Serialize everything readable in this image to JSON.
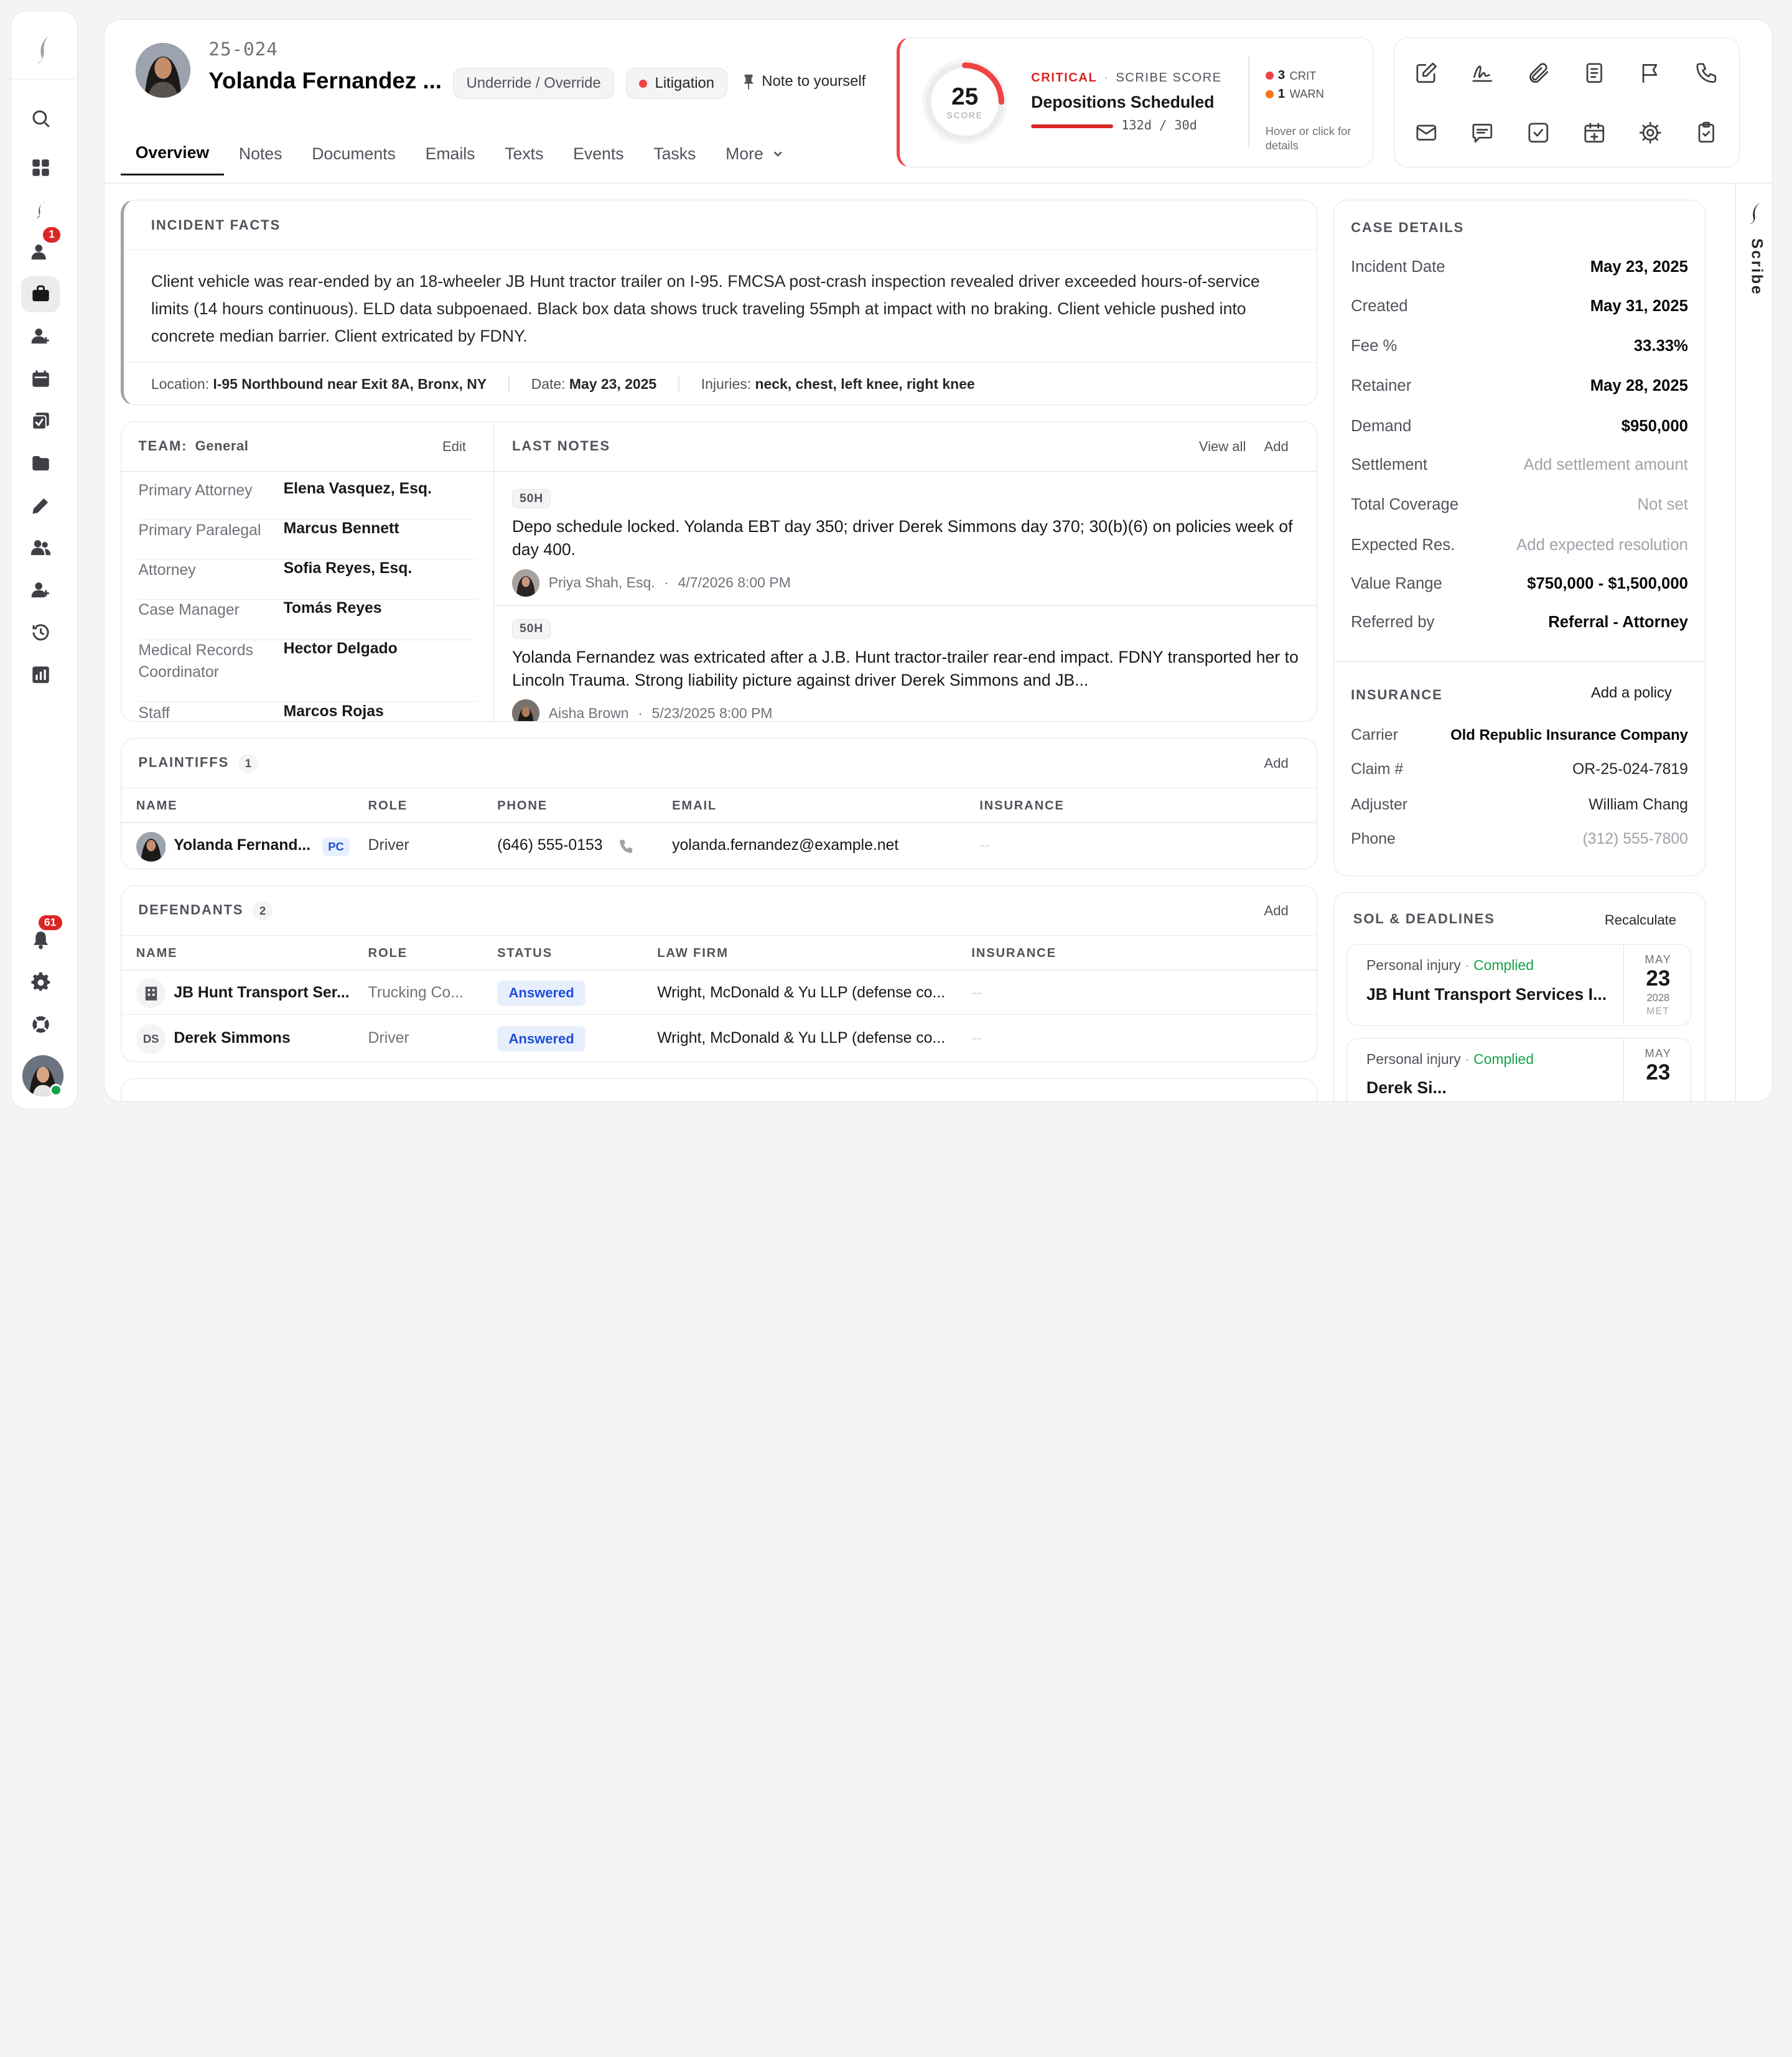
{
  "rail": {
    "badges": {
      "inbox": "1",
      "notifications": "61"
    }
  },
  "header": {
    "case_number": "25-024",
    "client_name": "Yolanda Fernandez ...",
    "chip_override": "Underride / Override",
    "chip_litigation": "Litigation",
    "note_to_self": "Note to yourself",
    "tabs": [
      "Overview",
      "Notes",
      "Documents",
      "Emails",
      "Texts",
      "Events",
      "Tasks",
      "More"
    ]
  },
  "score": {
    "value": "25",
    "value_num": 25,
    "label": "SCORE",
    "level": "CRITICAL",
    "sep": "·",
    "name": "SCRIBE SCORE",
    "title": "Depositions Scheduled",
    "days": "132d / 30d",
    "crit_count": "3",
    "crit_label": "CRIT",
    "warn_count": "1",
    "warn_label": "WARN",
    "hint": "Hover or click for details"
  },
  "incident": {
    "heading": "INCIDENT FACTS",
    "text": "Client vehicle was rear-ended by an 18-wheeler JB Hunt tractor trailer on I-95. FMCSA post-crash inspection revealed driver exceeded hours-of-service limits (14 hours continuous). ELD data subpoenaed. Black box data shows truck traveling 55mph at impact with no braking. Client vehicle pushed into concrete median barrier. Client extricated by FDNY.",
    "location_label": "Location:",
    "location": "I-95 Northbound near Exit 8A, Bronx, NY",
    "date_label": "Date:",
    "date": "May 23, 2025",
    "injuries_label": "Injuries:",
    "injuries": "neck, chest, left knee, right knee"
  },
  "team": {
    "heading": "TEAM:",
    "group": "General",
    "edit": "Edit",
    "rows": [
      {
        "role": "Primary Attorney",
        "name": "Elena Vasquez, Esq."
      },
      {
        "role": "Primary Paralegal",
        "name": "Marcus Bennett"
      },
      {
        "role": "Attorney",
        "name": "Sofia Reyes, Esq."
      },
      {
        "role": "Case Manager",
        "name": "Tomás Reyes"
      },
      {
        "role": "Medical Records Coordinator",
        "name": "Hector Delgado"
      },
      {
        "role": "Staff",
        "name": "Marcos Rojas"
      }
    ]
  },
  "notes": {
    "heading": "LAST NOTES",
    "view_all": "View all",
    "add": "Add",
    "items": [
      {
        "tag": "50H",
        "body": "Depo schedule locked. Yolanda EBT day 350; driver Derek Simmons day 370; 30(b)(6) on policies week of day 400.",
        "author": "Priya Shah, Esq.",
        "sep": "·",
        "time": "4/7/2026 8:00 PM"
      },
      {
        "tag": "50H",
        "body": "Yolanda Fernandez was extricated after a J.B. Hunt tractor-trailer rear-end impact. FDNY transported her to Lincoln Trauma. Strong liability picture against driver Derek Simmons and JB...",
        "author": "Aisha Brown",
        "sep": "·",
        "time": "5/23/2025 8:00 PM"
      }
    ]
  },
  "plaintiffs": {
    "heading": "PLAINTIFFS",
    "count": "1",
    "add": "Add",
    "columns": [
      "NAME",
      "ROLE",
      "PHONE",
      "EMAIL",
      "INSURANCE"
    ],
    "rows": [
      {
        "name": "Yolanda Fernand...",
        "badge": "PC",
        "role": "Driver",
        "phone": "(646) 555-0153",
        "email": "yolanda.fernandez@example.net",
        "insurance": "--"
      }
    ]
  },
  "defendants": {
    "heading": "DEFENDANTS",
    "count": "2",
    "add": "Add",
    "columns": [
      "NAME",
      "ROLE",
      "STATUS",
      "LAW FIRM",
      "INSURANCE"
    ],
    "rows": [
      {
        "initials": "",
        "name": "JB Hunt Transport Ser...",
        "role": "Trucking Co...",
        "status": "Answered",
        "firm": "Wright, McDonald & Yu LLP (defense co...",
        "insurance": "--"
      },
      {
        "initials": "DS",
        "name": "Derek Simmons",
        "role": "Driver",
        "status": "Answered",
        "firm": "Wright, McDonald & Yu LLP (defense co...",
        "insurance": "--"
      }
    ]
  },
  "case_details": {
    "heading": "CASE DETAILS",
    "rows": [
      {
        "label": "Incident Date",
        "value": "May 23, 2025"
      },
      {
        "label": "Created",
        "value": "May 31, 2025"
      },
      {
        "label": "Fee %",
        "value": "33.33%"
      },
      {
        "label": "Retainer",
        "value": "May 28, 2025"
      },
      {
        "label": "Demand",
        "value": "$950,000"
      },
      {
        "label": "Settlement",
        "value": "Add settlement amount"
      },
      {
        "label": "Total Coverage",
        "value": "Not set"
      },
      {
        "label": "Expected Res.",
        "value": "Add expected resolution"
      },
      {
        "label": "Value Range",
        "value": "$750,000 - $1,500,000"
      },
      {
        "label": "Referred by",
        "value": "Referral - Attorney"
      }
    ]
  },
  "insurance": {
    "heading": "INSURANCE",
    "add": "Add a policy",
    "rows": [
      {
        "label": "Carrier",
        "value": "Old Republic Insurance Company"
      },
      {
        "label": "Claim #",
        "value": "OR-25-024-7819"
      },
      {
        "label": "Adjuster",
        "value": "William Chang"
      },
      {
        "label": "Phone",
        "value": "(312) 555-7800"
      }
    ]
  },
  "sol": {
    "heading": "SOL & DEADLINES",
    "recalc": "Recalculate",
    "items": [
      {
        "type": "Personal injury",
        "sep": "·",
        "status": "Complied",
        "name": "JB Hunt Transport Services I...",
        "month": "MAY",
        "day": "23",
        "year": "2028",
        "state": "MET"
      },
      {
        "type": "Personal injury",
        "sep": "·",
        "status": "Complied",
        "name": "Derek Si...",
        "month": "MAY",
        "day": "23",
        "year": "",
        "state": ""
      }
    ]
  },
  "scribe_tab": "Scribe",
  "colors": {
    "critical": "#dc2626",
    "warn": "#f97316",
    "accent": "#1d4ed8",
    "complied": "#16a34a"
  }
}
